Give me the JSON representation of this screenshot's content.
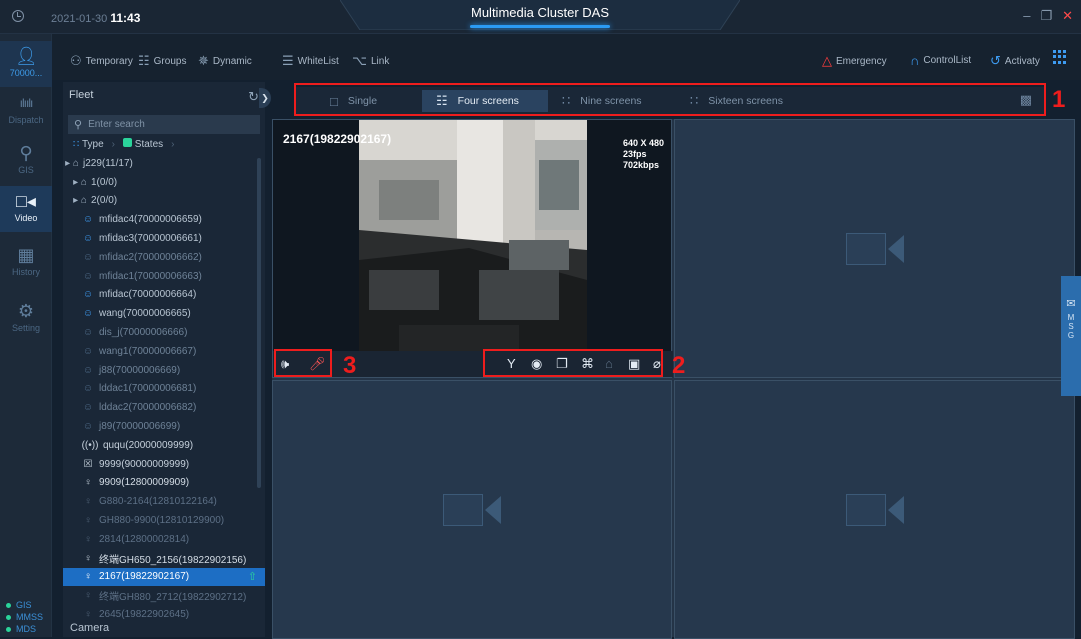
{
  "header": {
    "date": "2021-01-30",
    "time": "11:43",
    "title": "Multimedia Cluster DAS",
    "minimize": "–",
    "restore": "❐",
    "close": "✕"
  },
  "nav": {
    "user_label": "70000...",
    "items": [
      {
        "label": "Dispatch",
        "icon": "dispatch-waveform-icon"
      },
      {
        "label": "GIS",
        "icon": "map-pin-icon"
      },
      {
        "label": "Video",
        "icon": "video-camera-icon"
      },
      {
        "label": "History",
        "icon": "calendar-grid-icon"
      },
      {
        "label": "Setting",
        "icon": "gear-icon"
      }
    ],
    "status": [
      "GIS",
      "MMSS",
      "MDS"
    ]
  },
  "toolbar": {
    "temporary": "Temporary",
    "groups": "Groups",
    "dynamic": "Dynamic",
    "whitelist": "WhiteList",
    "link": "Link",
    "emergency": "Emergency",
    "controllist": "ControlList",
    "activate": "Activaty"
  },
  "tree": {
    "title": "Fleet",
    "search_placeholder": "Enter search",
    "type_filter": "Type",
    "states_filter": "States",
    "camera_label": "Camera",
    "rows": [
      {
        "label": "j229(11/17)",
        "indent": 0,
        "style": "group"
      },
      {
        "label": "1(0/0)",
        "indent": 1,
        "style": "group"
      },
      {
        "label": "2(0/0)",
        "indent": 1,
        "style": "group"
      },
      {
        "label": "mfidac4(70000006659)",
        "indent": 2,
        "style": "online"
      },
      {
        "label": "mfidac3(70000006661)",
        "indent": 2,
        "style": "online"
      },
      {
        "label": "mfidac2(70000006662)",
        "indent": 2,
        "style": "offline"
      },
      {
        "label": "mfidac1(70000006663)",
        "indent": 2,
        "style": "offline"
      },
      {
        "label": "mfidac(70000006664)",
        "indent": 2,
        "style": "online"
      },
      {
        "label": "wang(70000006665)",
        "indent": 2,
        "style": "online"
      },
      {
        "label": "dis_j(70000006666)",
        "indent": 2,
        "style": "offline"
      },
      {
        "label": "wang1(70000006667)",
        "indent": 2,
        "style": "offline"
      },
      {
        "label": "j88(70000006669)",
        "indent": 2,
        "style": "offline"
      },
      {
        "label": "lddac1(70000006681)",
        "indent": 2,
        "style": "offline"
      },
      {
        "label": "lddac2(70000006682)",
        "indent": 2,
        "style": "offline"
      },
      {
        "label": "j89(70000006699)",
        "indent": 2,
        "style": "offline"
      },
      {
        "label": "ququ(20000009999)",
        "indent": 2,
        "style": "radio"
      },
      {
        "label": "9999(90000009999)",
        "indent": 2,
        "style": "device"
      },
      {
        "label": "9909(12800009909)",
        "indent": 2,
        "style": "person"
      },
      {
        "label": "G880-2164(12810122164)",
        "indent": 2,
        "style": "person-dim"
      },
      {
        "label": "GH880-9900(12810129900)",
        "indent": 2,
        "style": "person-dim"
      },
      {
        "label": "2814(12800002814)",
        "indent": 2,
        "style": "person-dim"
      },
      {
        "label": "终端GH650_2156(19822902156)",
        "indent": 2,
        "style": "person"
      },
      {
        "label": "2167(19822902167)",
        "indent": 2,
        "style": "selected"
      },
      {
        "label": "终端GH880_2712(19822902712)",
        "indent": 2,
        "style": "person-dim"
      },
      {
        "label": "2645(19822902645)",
        "indent": 2,
        "style": "person-dim"
      }
    ]
  },
  "modes": {
    "single": "Single",
    "four": "Four screens",
    "nine": "Nine screens",
    "sixteen": "Sixteen screens",
    "active": "four"
  },
  "video": {
    "channel_title": "2167(19822902167)",
    "resolution": "640 X 480",
    "rate": "23fps 702kbps",
    "left_controls": [
      "speaker-icon",
      "mic-mute-icon"
    ],
    "right_controls": [
      "ptz-icon",
      "record-icon",
      "snapshot-icon",
      "crop-icon",
      "lock-icon",
      "save-icon",
      "signal-off-icon"
    ]
  },
  "annotations": {
    "n1": "1",
    "n2": "2",
    "n3": "3"
  },
  "msg_tab": "M S G",
  "colors": {
    "accent": "#2b9bf4",
    "selected_row": "#1d6ec4",
    "emergency": "#ff3d3d",
    "online": "#3e9cf2",
    "annotation": "#ee1d1d"
  }
}
